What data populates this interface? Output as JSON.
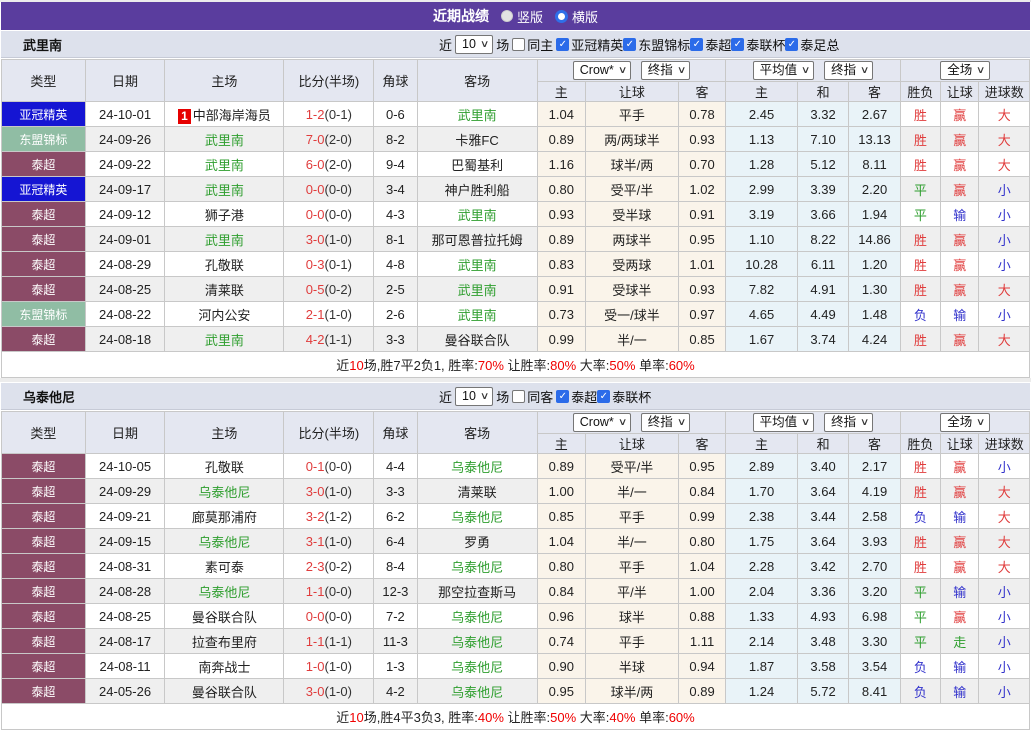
{
  "title_bar": {
    "title": "近期战绩",
    "radio_vertical": "竖版",
    "radio_horizontal": "横版"
  },
  "filter_labels": {
    "near": "近",
    "games": "场"
  },
  "columns": {
    "type": "类型",
    "date": "日期",
    "home": "主场",
    "score": "比分(半场)",
    "corner": "角球",
    "away": "客场",
    "odds_home": "主",
    "handicap": "让球",
    "odds_away": "客",
    "avg_home": "主",
    "avg_draw": "和",
    "avg_away": "客",
    "result": "胜负",
    "hcap_res": "让球",
    "goals": "进球数"
  },
  "dropdowns": {
    "source": "Crow*",
    "final1": "终指",
    "average": "平均值",
    "final2": "终指",
    "scope": "全场"
  },
  "league_colors": {
    "亚冠精英": "#1515d3",
    "东盟锦标": "#90bda4",
    "泰超": "#8b4b67"
  },
  "result_colors": {
    "胜": "#e03c3c",
    "赢": "#e03c3c",
    "大": "#e03c3c",
    "平": "#2e9e2e",
    "走": "#2e9e2e",
    "负": "#3333cc",
    "输": "#3333cc",
    "小": "#3333cc"
  },
  "tables": [
    {
      "team": "武里南",
      "filter": {
        "count": "10",
        "same_label": "同主",
        "leagues": [
          "亚冠精英",
          "东盟锦标",
          "泰超",
          "泰联杯",
          "泰足总"
        ]
      },
      "rows": [
        {
          "league": "亚冠精英",
          "date": "24-10-01",
          "home": "中部海岸海员",
          "home_badge": "1",
          "home_hl": false,
          "score": "1-2",
          "half": "(0-1)",
          "corner": "0-6",
          "away": "武里南",
          "away_hl": true,
          "odds_home": "1.04",
          "handicap": "平手",
          "odds_away": "0.78",
          "avg_home": "2.45",
          "avg_draw": "3.32",
          "avg_away": "2.67",
          "result": "胜",
          "hcap_res": "赢",
          "goals": "大"
        },
        {
          "league": "东盟锦标",
          "date": "24-09-26",
          "home": "武里南",
          "home_hl": true,
          "score": "7-0",
          "half": "(2-0)",
          "corner": "8-2",
          "away": "卡雅FC",
          "away_hl": false,
          "odds_home": "0.89",
          "handicap": "两/两球半",
          "odds_away": "0.93",
          "avg_home": "1.13",
          "avg_draw": "7.10",
          "avg_away": "13.13",
          "result": "胜",
          "hcap_res": "赢",
          "goals": "大"
        },
        {
          "league": "泰超",
          "date": "24-09-22",
          "home": "武里南",
          "home_hl": true,
          "score": "6-0",
          "half": "(2-0)",
          "corner": "9-4",
          "away": "巴蜀基利",
          "away_hl": false,
          "odds_home": "1.16",
          "handicap": "球半/两",
          "odds_away": "0.70",
          "avg_home": "1.28",
          "avg_draw": "5.12",
          "avg_away": "8.11",
          "result": "胜",
          "hcap_res": "赢",
          "goals": "大"
        },
        {
          "league": "亚冠精英",
          "date": "24-09-17",
          "home": "武里南",
          "home_hl": true,
          "score": "0-0",
          "half": "(0-0)",
          "corner": "3-4",
          "away": "神户胜利船",
          "away_hl": false,
          "odds_home": "0.80",
          "handicap": "受平/半",
          "odds_away": "1.02",
          "avg_home": "2.99",
          "avg_draw": "3.39",
          "avg_away": "2.20",
          "result": "平",
          "hcap_res": "赢",
          "goals": "小"
        },
        {
          "league": "泰超",
          "date": "24-09-12",
          "home": "狮子港",
          "home_hl": false,
          "score": "0-0",
          "half": "(0-0)",
          "corner": "4-3",
          "away": "武里南",
          "away_hl": true,
          "odds_home": "0.93",
          "handicap": "受半球",
          "odds_away": "0.91",
          "avg_home": "3.19",
          "avg_draw": "3.66",
          "avg_away": "1.94",
          "result": "平",
          "hcap_res": "输",
          "goals": "小"
        },
        {
          "league": "泰超",
          "date": "24-09-01",
          "home": "武里南",
          "home_hl": true,
          "score": "3-0",
          "half": "(1-0)",
          "corner": "8-1",
          "away": "那可恩普拉托姆",
          "away_hl": false,
          "odds_home": "0.89",
          "handicap": "两球半",
          "odds_away": "0.95",
          "avg_home": "1.10",
          "avg_draw": "8.22",
          "avg_away": "14.86",
          "result": "胜",
          "hcap_res": "赢",
          "goals": "小"
        },
        {
          "league": "泰超",
          "date": "24-08-29",
          "home": "孔敬联",
          "home_hl": false,
          "score": "0-3",
          "half": "(0-1)",
          "corner": "4-8",
          "away": "武里南",
          "away_hl": true,
          "odds_home": "0.83",
          "handicap": "受两球",
          "odds_away": "1.01",
          "avg_home": "10.28",
          "avg_draw": "6.11",
          "avg_away": "1.20",
          "result": "胜",
          "hcap_res": "赢",
          "goals": "小"
        },
        {
          "league": "泰超",
          "date": "24-08-25",
          "home": "清莱联",
          "home_hl": false,
          "score": "0-5",
          "half": "(0-2)",
          "corner": "2-5",
          "away": "武里南",
          "away_hl": true,
          "odds_home": "0.91",
          "handicap": "受球半",
          "odds_away": "0.93",
          "avg_home": "7.82",
          "avg_draw": "4.91",
          "avg_away": "1.30",
          "result": "胜",
          "hcap_res": "赢",
          "goals": "大"
        },
        {
          "league": "东盟锦标",
          "date": "24-08-22",
          "home": "河内公安",
          "home_hl": false,
          "score": "2-1",
          "half": "(1-0)",
          "corner": "2-6",
          "away": "武里南",
          "away_hl": true,
          "odds_home": "0.73",
          "handicap": "受一/球半",
          "odds_away": "0.97",
          "avg_home": "4.65",
          "avg_draw": "4.49",
          "avg_away": "1.48",
          "result": "负",
          "hcap_res": "输",
          "goals": "小"
        },
        {
          "league": "泰超",
          "date": "24-08-18",
          "home": "武里南",
          "home_hl": true,
          "score": "4-2",
          "half": "(1-1)",
          "corner": "3-3",
          "away": "曼谷联合队",
          "away_hl": false,
          "odds_home": "0.99",
          "handicap": "半/一",
          "odds_away": "0.85",
          "avg_home": "1.67",
          "avg_draw": "3.74",
          "avg_away": "4.24",
          "result": "胜",
          "hcap_res": "赢",
          "goals": "大"
        }
      ],
      "summary": [
        {
          "t": "近"
        },
        {
          "t": "10",
          "red": true
        },
        {
          "t": "场,胜7平2负1, 胜率:"
        },
        {
          "t": "70%",
          "red": true
        },
        {
          "t": " 让胜率:"
        },
        {
          "t": "80%",
          "red": true
        },
        {
          "t": " 大率:"
        },
        {
          "t": "50%",
          "red": true
        },
        {
          "t": " 单率:"
        },
        {
          "t": "60%",
          "red": true
        }
      ]
    },
    {
      "team": "乌泰他尼",
      "filter": {
        "count": "10",
        "same_label": "同客",
        "leagues": [
          "泰超",
          "泰联杯"
        ]
      },
      "rows": [
        {
          "league": "泰超",
          "date": "24-10-05",
          "home": "孔敬联",
          "home_hl": false,
          "score": "0-1",
          "half": "(0-0)",
          "corner": "4-4",
          "away": "乌泰他尼",
          "away_hl": true,
          "odds_home": "0.89",
          "handicap": "受平/半",
          "odds_away": "0.95",
          "avg_home": "2.89",
          "avg_draw": "3.40",
          "avg_away": "2.17",
          "result": "胜",
          "hcap_res": "赢",
          "goals": "小"
        },
        {
          "league": "泰超",
          "date": "24-09-29",
          "home": "乌泰他尼",
          "home_hl": true,
          "score": "3-0",
          "half": "(1-0)",
          "corner": "3-3",
          "away": "清莱联",
          "away_hl": false,
          "odds_home": "1.00",
          "handicap": "半/一",
          "odds_away": "0.84",
          "avg_home": "1.70",
          "avg_draw": "3.64",
          "avg_away": "4.19",
          "result": "胜",
          "hcap_res": "赢",
          "goals": "大"
        },
        {
          "league": "泰超",
          "date": "24-09-21",
          "home": "廊莫那浦府",
          "home_hl": false,
          "score": "3-2",
          "half": "(1-2)",
          "corner": "6-2",
          "away": "乌泰他尼",
          "away_hl": true,
          "odds_home": "0.85",
          "handicap": "平手",
          "odds_away": "0.99",
          "avg_home": "2.38",
          "avg_draw": "3.44",
          "avg_away": "2.58",
          "result": "负",
          "hcap_res": "输",
          "goals": "大"
        },
        {
          "league": "泰超",
          "date": "24-09-15",
          "home": "乌泰他尼",
          "home_hl": true,
          "score": "3-1",
          "half": "(1-0)",
          "corner": "6-4",
          "away": "罗勇",
          "away_hl": false,
          "odds_home": "1.04",
          "handicap": "半/一",
          "odds_away": "0.80",
          "avg_home": "1.75",
          "avg_draw": "3.64",
          "avg_away": "3.93",
          "result": "胜",
          "hcap_res": "赢",
          "goals": "大"
        },
        {
          "league": "泰超",
          "date": "24-08-31",
          "home": "素可泰",
          "home_hl": false,
          "score": "2-3",
          "half": "(0-2)",
          "corner": "8-4",
          "away": "乌泰他尼",
          "away_hl": true,
          "odds_home": "0.80",
          "handicap": "平手",
          "odds_away": "1.04",
          "avg_home": "2.28",
          "avg_draw": "3.42",
          "avg_away": "2.70",
          "result": "胜",
          "hcap_res": "赢",
          "goals": "大"
        },
        {
          "league": "泰超",
          "date": "24-08-28",
          "home": "乌泰他尼",
          "home_hl": true,
          "score": "1-1",
          "half": "(0-0)",
          "corner": "12-3",
          "away": "那空拉查斯马",
          "away_hl": false,
          "odds_home": "0.84",
          "handicap": "平/半",
          "odds_away": "1.00",
          "avg_home": "2.04",
          "avg_draw": "3.36",
          "avg_away": "3.20",
          "result": "平",
          "hcap_res": "输",
          "goals": "小"
        },
        {
          "league": "泰超",
          "date": "24-08-25",
          "home": "曼谷联合队",
          "home_hl": false,
          "score": "0-0",
          "half": "(0-0)",
          "corner": "7-2",
          "away": "乌泰他尼",
          "away_hl": true,
          "odds_home": "0.96",
          "handicap": "球半",
          "odds_away": "0.88",
          "avg_home": "1.33",
          "avg_draw": "4.93",
          "avg_away": "6.98",
          "result": "平",
          "hcap_res": "赢",
          "goals": "小"
        },
        {
          "league": "泰超",
          "date": "24-08-17",
          "home": "拉查布里府",
          "home_hl": false,
          "score": "1-1",
          "half": "(1-1)",
          "corner": "11-3",
          "away": "乌泰他尼",
          "away_hl": true,
          "odds_home": "0.74",
          "handicap": "平手",
          "odds_away": "1.11",
          "avg_home": "2.14",
          "avg_draw": "3.48",
          "avg_away": "3.30",
          "result": "平",
          "hcap_res": "走",
          "goals": "小"
        },
        {
          "league": "泰超",
          "date": "24-08-11",
          "home": "南奔战士",
          "home_hl": false,
          "score": "1-0",
          "half": "(1-0)",
          "corner": "1-3",
          "away": "乌泰他尼",
          "away_hl": true,
          "odds_home": "0.90",
          "handicap": "半球",
          "odds_away": "0.94",
          "avg_home": "1.87",
          "avg_draw": "3.58",
          "avg_away": "3.54",
          "result": "负",
          "hcap_res": "输",
          "goals": "小"
        },
        {
          "league": "泰超",
          "date": "24-05-26",
          "home": "曼谷联合队",
          "home_hl": false,
          "score": "3-0",
          "half": "(1-0)",
          "corner": "4-2",
          "away": "乌泰他尼",
          "away_hl": true,
          "odds_home": "0.95",
          "handicap": "球半/两",
          "odds_away": "0.89",
          "avg_home": "1.24",
          "avg_draw": "5.72",
          "avg_away": "8.41",
          "result": "负",
          "hcap_res": "输",
          "goals": "小"
        }
      ],
      "summary": [
        {
          "t": "近"
        },
        {
          "t": "10",
          "red": true
        },
        {
          "t": "场,胜4平3负3, 胜率:"
        },
        {
          "t": "40%",
          "red": true
        },
        {
          "t": " 让胜率:"
        },
        {
          "t": "50%",
          "red": true
        },
        {
          "t": " 大率:"
        },
        {
          "t": "40%",
          "red": true
        },
        {
          "t": " 单率:"
        },
        {
          "t": "60%",
          "red": true
        }
      ]
    }
  ]
}
